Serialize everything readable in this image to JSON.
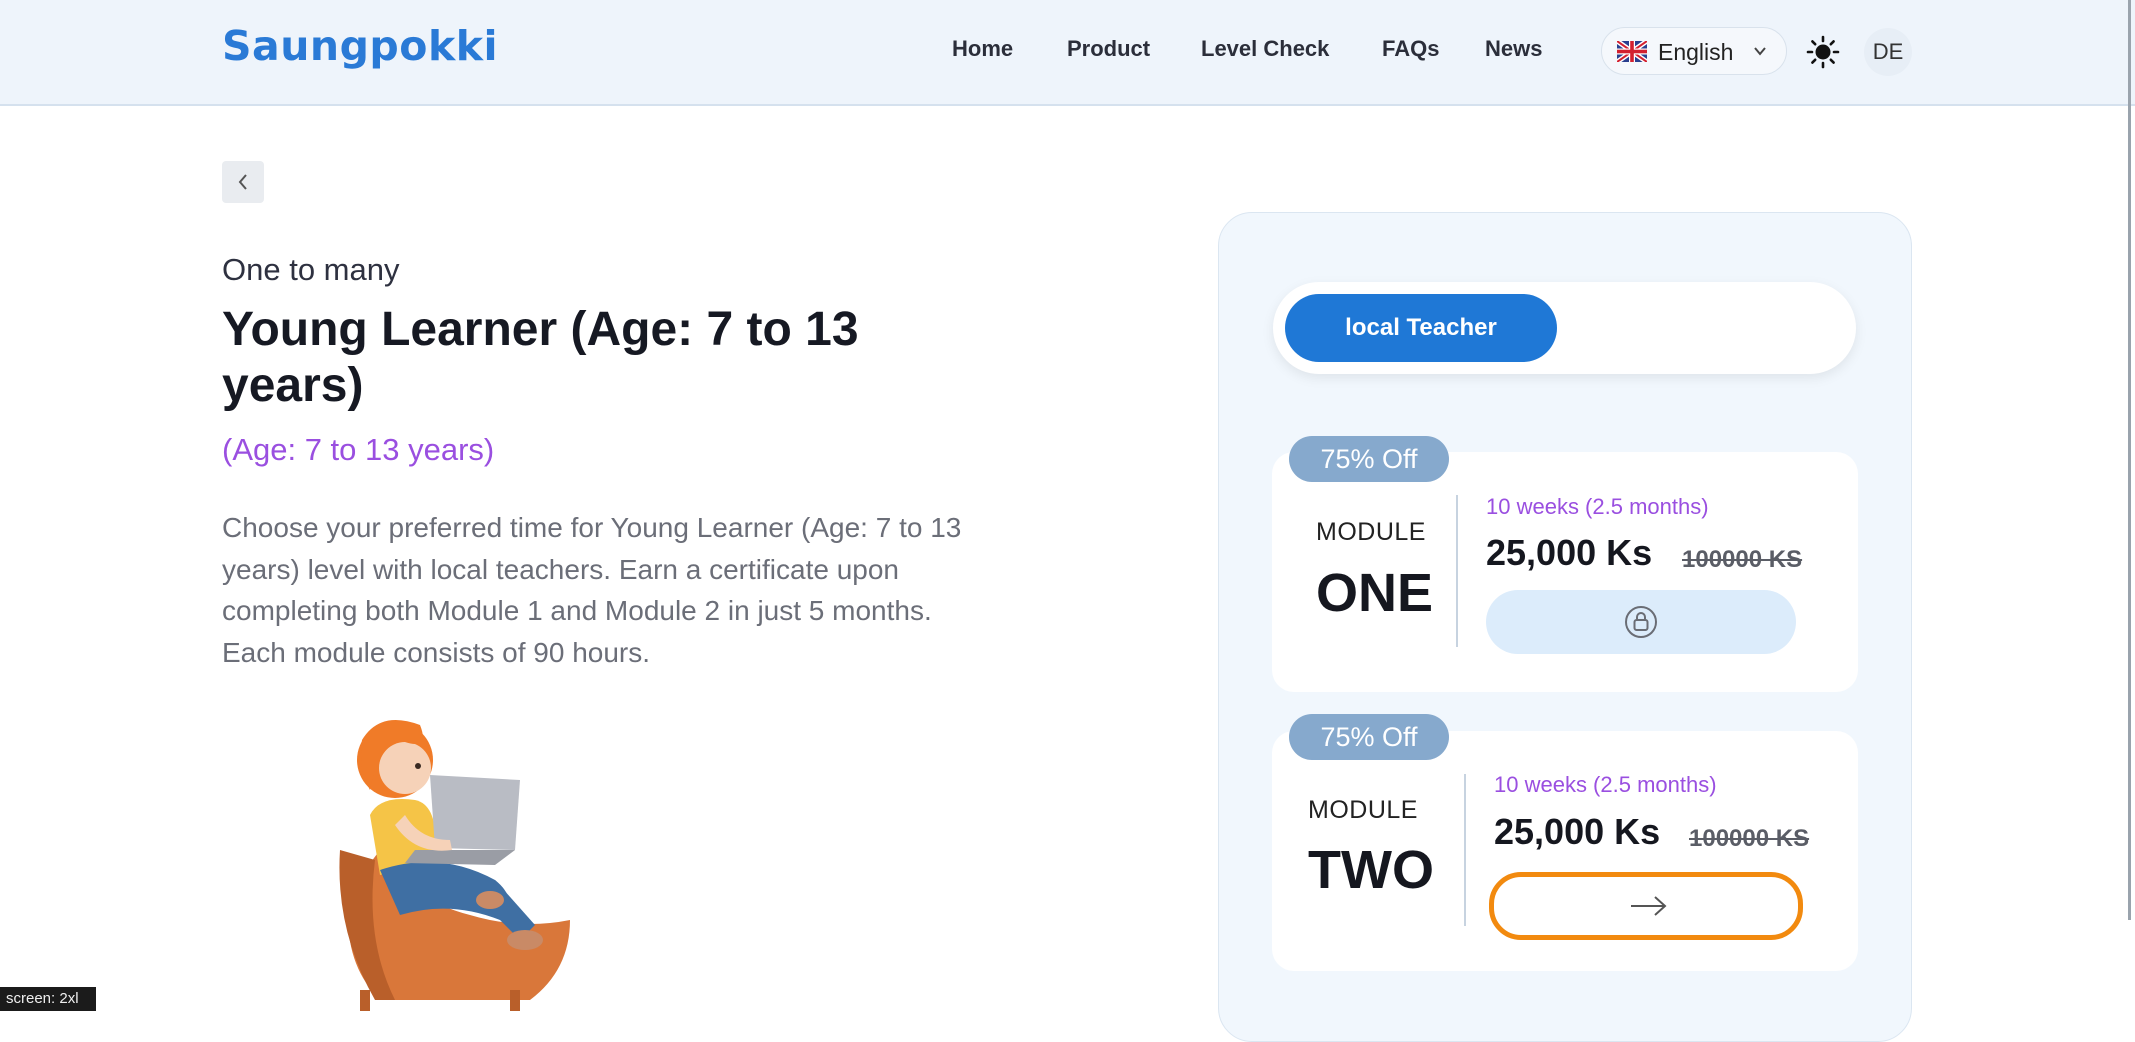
{
  "header": {
    "logo": "Saungpokki",
    "nav": [
      "Home",
      "Product",
      "Level Check",
      "FAQs",
      "News"
    ],
    "language": "English",
    "user_initials": "DE"
  },
  "course": {
    "kicker": "One to many",
    "title": "Young Learner (Age: 7 to 13 years)",
    "subtitle": "(Age: 7 to 13 years)",
    "description": "Choose your preferred time for Young Learner (Age: 7 to 13 years) level with local teachers. Earn a certificate upon completing both Module 1 and Module 2 in just 5 months. Each module consists of 90 hours."
  },
  "panel": {
    "active_tab": "local Teacher",
    "modules": [
      {
        "badge": "75% Off",
        "label": "MODULE",
        "number": "ONE",
        "duration": "10 weeks (2.5 months)",
        "price": "25,000 Ks",
        "old_price": "100000 KS",
        "action_icon": "lock-icon",
        "locked": true
      },
      {
        "badge": "75% Off",
        "label": "MODULE",
        "number": "TWO",
        "duration": "10 weeks (2.5 months)",
        "price": "25,000 Ks",
        "old_price": "100000 KS",
        "action_icon": "arrow-right-icon",
        "locked": false
      }
    ]
  },
  "debug": {
    "screen_tag": "screen: 2xl"
  },
  "colors": {
    "brand": "#2a7ad6",
    "accent_purple": "#9a4fe0",
    "tab_active": "#1f78d6",
    "badge": "#86a9cd",
    "highlight": "#f28a0f"
  }
}
